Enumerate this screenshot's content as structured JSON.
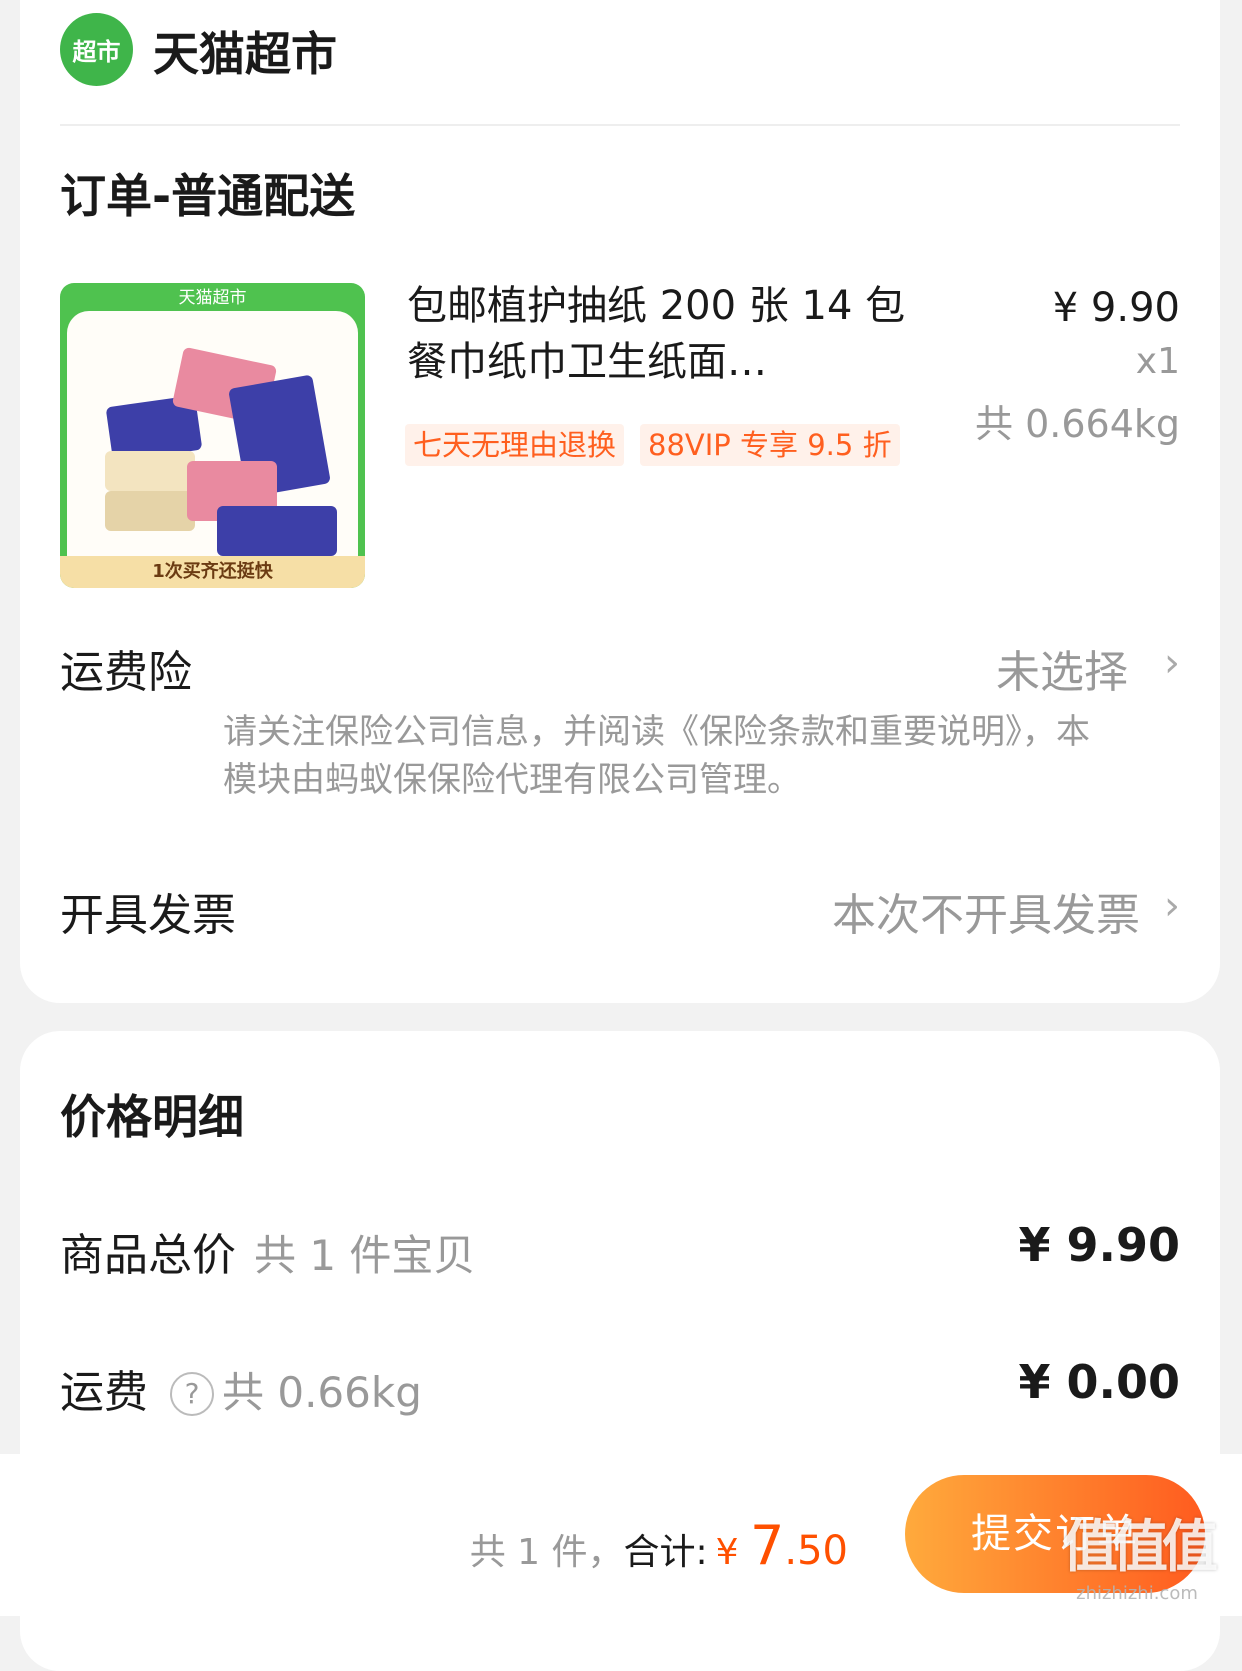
{
  "shop": {
    "logo_text": "超市",
    "name": "天猫超市"
  },
  "order": {
    "section_title": "订单-普通配送",
    "product": {
      "image_banner_top": "天猫超市",
      "image_banner_bottom": "1次买齐还挺快",
      "title": "包邮植护抽纸 200 张 14 包餐巾纸巾卫生纸面…",
      "tags": [
        "七天无理由退换",
        "88VIP 专享 9.5 折"
      ],
      "unit_price": "¥ 9.90",
      "quantity": "x1",
      "weight": "共 0.664kg"
    },
    "shipping_insurance": {
      "label": "运费险",
      "value": "未选择",
      "notice": "请关注保险公司信息，并阅读《保险条款和重要说明》，本模块由蚂蚁保保险代理有限公司管理。"
    },
    "invoice": {
      "label": "开具发票",
      "value": "本次不开具发票"
    }
  },
  "price_detail": {
    "title": "价格明细",
    "goods_total": {
      "label": "商品总价",
      "sub": "共 1 件宝贝",
      "value": "¥ 9.90"
    },
    "shipping": {
      "label": "运费",
      "sub": "共 0.66kg",
      "value": "¥ 0.00"
    }
  },
  "bottom_bar": {
    "count_text": "共 1 件，",
    "total_label": "合计:",
    "currency": "¥",
    "total_int": "7",
    "total_dec": ".50",
    "submit_label": "提交订单"
  },
  "watermark": {
    "logo": "值值值",
    "url": "zhizhizhi.com"
  },
  "colors": {
    "accent": "#ff5000",
    "brand_green": "#3fb54a",
    "tag_bg": "#fff1ea"
  }
}
